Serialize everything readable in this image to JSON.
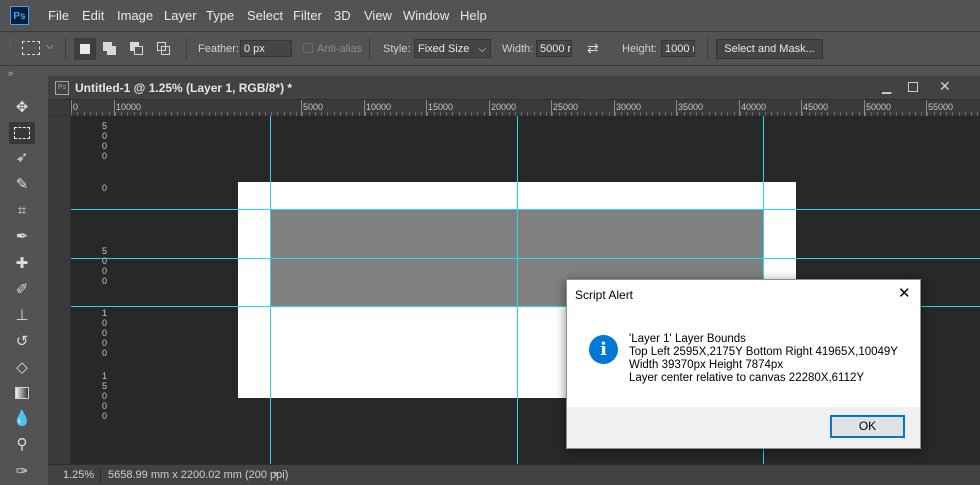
{
  "app": {
    "logo_text": "Ps"
  },
  "menu": [
    "File",
    "Edit",
    "Image",
    "Layer",
    "Type",
    "Select",
    "Filter",
    "3D",
    "View",
    "Window",
    "Help"
  ],
  "options": {
    "feather_label": "Feather:",
    "feather_value": "0 px",
    "antialias_label": "Anti-alias",
    "style_label": "Style:",
    "style_value": "Fixed Size",
    "width_label": "Width:",
    "width_value": "5000 n",
    "height_label": "Height:",
    "height_value": "1000 n",
    "select_mask_label": "Select and Mask..."
  },
  "document": {
    "tab_title": "Untitled-1 @ 1.25% (Layer 1, RGB/8*) *",
    "zoom": "1.25%",
    "doc_info": "5658.99 mm x 2200.02 mm (200 ppi)"
  },
  "ruler": {
    "top_labels": [
      "0",
      "10000",
      "5000",
      "10000",
      "15000",
      "20000",
      "25000",
      "30000",
      "35000",
      "40000",
      "45000",
      "50000",
      "55000"
    ],
    "left_labels": [
      "5",
      "0",
      "0",
      "0",
      "0",
      "5",
      "0",
      "0",
      "0",
      "1",
      "0",
      "0",
      "0",
      "0",
      "1",
      "5",
      "0",
      "0",
      "0"
    ]
  },
  "dialog": {
    "title": "Script Alert",
    "icon": "info-icon",
    "line1": "'Layer 1' Layer Bounds",
    "line2": "Top Left 2595X,2175Y   Bottom Right 41965X,10049Y",
    "line3": "Width 39370px   Height 7874px",
    "line4": "Layer center relative to canvas 22280X,6112Y",
    "ok_label": "OK"
  },
  "colors": {
    "guide": "#29d6ef",
    "dialog_icon": "#0078d7"
  }
}
